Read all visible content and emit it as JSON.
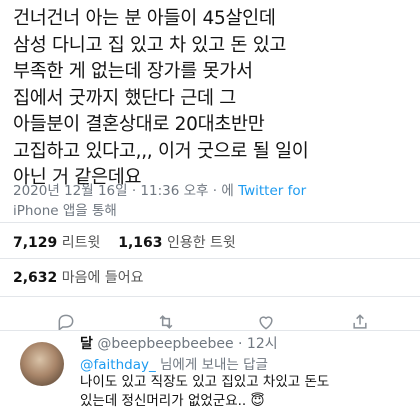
{
  "tweet": {
    "text": "건너건너 아는 분 아들이 45살인데\n삼성 다니고 집 있고 차 있고 돈 있고\n부족한 게 없는데 장가를 못가서\n집에서 굿까지 했단다 근데 그\n아들분이 결혼상대로 20대초반만\n고집하고 있다고,,, 이거 굿으로 될 일이\n아닌 거 같은데요",
    "timestamp": "2020년 12월 16일 · 11:36 오후 · 에",
    "via": "Twitter for",
    "device": "iPhone 앱을 통해"
  },
  "stats": {
    "retweets_count": "7,129",
    "retweets_label": "리트윗",
    "quotes_count": "1,163",
    "quotes_label": "인용한 트윗",
    "likes_count": "2,632",
    "likes_label": "마음에 들어요"
  },
  "actions": [
    "reply-icon",
    "retweet-icon",
    "like-icon",
    "share-icon"
  ],
  "reply": {
    "name": "달",
    "handle": "@beepbeepbeebee",
    "time": "· 12시",
    "to_mention": "@faithday_",
    "to_suffix": "님에게 보내는 답글",
    "text": "나이도 있고 직장도 있고 집있고 차있고 돈도\n있는데 정신머리가 없었군요.. 😇"
  }
}
